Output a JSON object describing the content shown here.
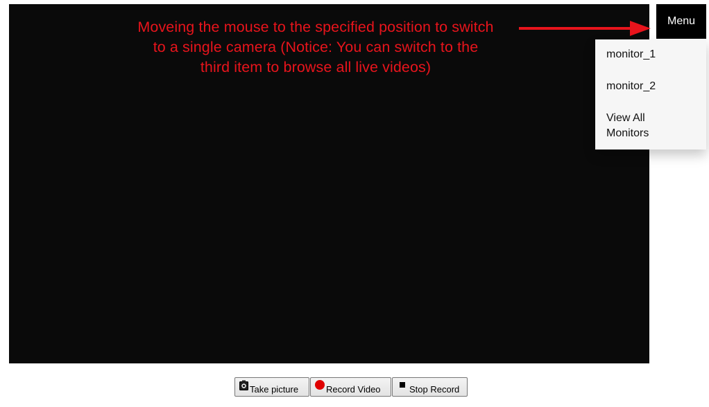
{
  "annotation": {
    "line1": "Moveing the mouse to the specified position to switch",
    "line2": "to a single camera (Notice: You can switch to the",
    "line3": "third item to browse all live videos)",
    "color": "#e8141c"
  },
  "menu": {
    "button_label": "Menu",
    "items": [
      {
        "label": "monitor_1"
      },
      {
        "label": "monitor_2"
      },
      {
        "label": "View All Monitors"
      }
    ]
  },
  "controls": {
    "take_picture": {
      "label": "Take picture",
      "icon": "camera-icon"
    },
    "record_video": {
      "label": "Record Video",
      "icon": "record-dot-icon"
    },
    "stop_record": {
      "label": "Stop Record",
      "icon": "stop-square-icon"
    }
  },
  "colors": {
    "video_background": "#0a0a0a",
    "menu_button_bg": "#000000",
    "dropdown_bg": "#f6f6f6",
    "record_red": "#e00000"
  }
}
